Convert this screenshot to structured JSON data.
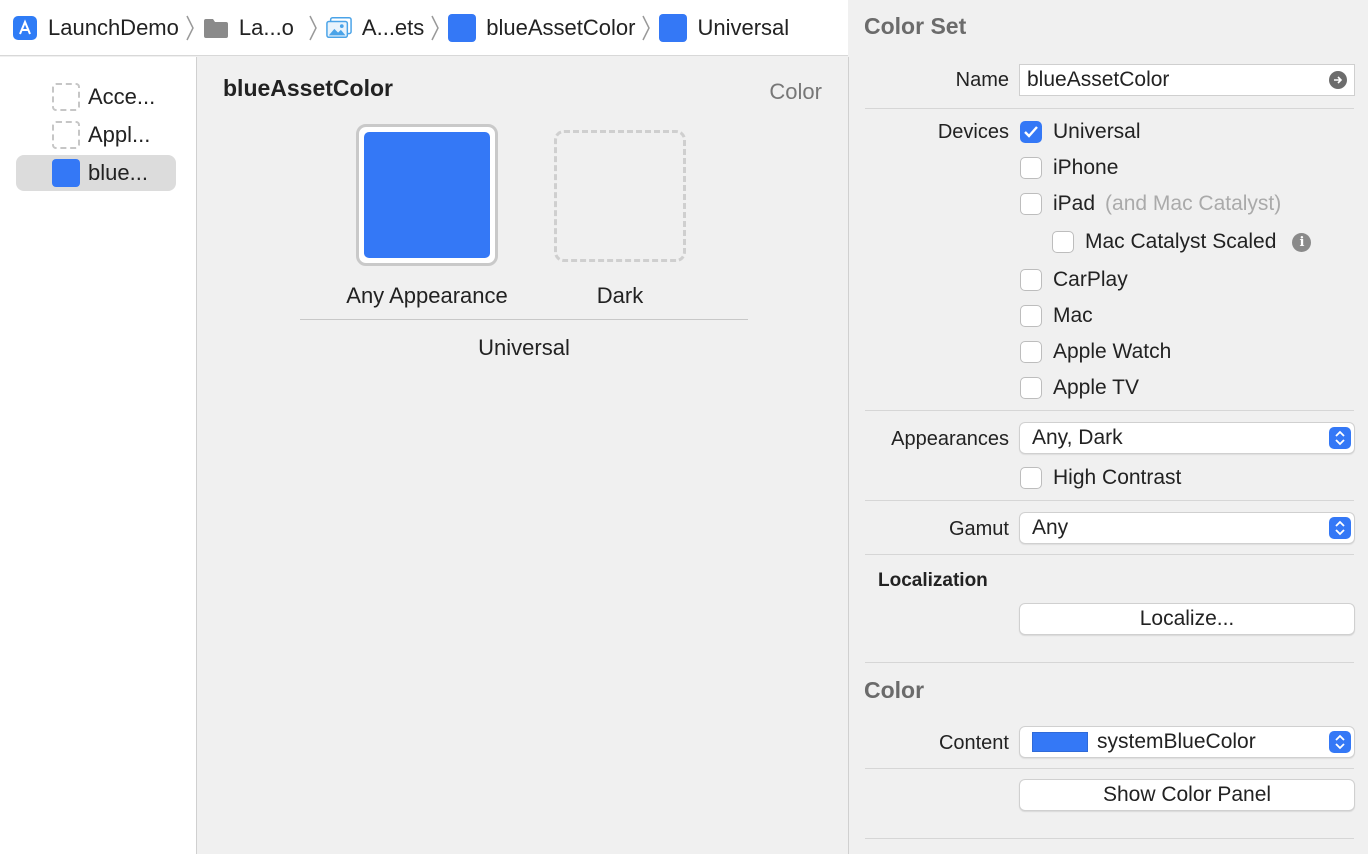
{
  "breadcrumb": {
    "items": [
      {
        "label": "LaunchDemo",
        "icon": "xcode-app-icon"
      },
      {
        "label": "La...o",
        "icon": "folder-icon"
      },
      {
        "label": "A...ets",
        "icon": "asset-catalog-icon"
      },
      {
        "label": "blueAssetColor",
        "icon": "color-swatch-icon"
      },
      {
        "label": "Universal",
        "icon": "color-swatch-icon"
      }
    ]
  },
  "asset_list": {
    "items": [
      {
        "label": "Acce..."
      },
      {
        "label": "Appl..."
      },
      {
        "label": "blue..."
      }
    ]
  },
  "editor": {
    "title": "blueAssetColor",
    "type": "Color",
    "wells": {
      "any": "Any Appearance",
      "dark": "Dark"
    },
    "group": "Universal"
  },
  "inspector": {
    "color_set": {
      "title": "Color Set",
      "name_label": "Name",
      "name_value": "blueAssetColor",
      "devices_label": "Devices",
      "devices": {
        "universal": "Universal",
        "iphone": "iPhone",
        "ipad": "iPad",
        "ipad_note": "(and Mac Catalyst)",
        "mac_catalyst_scaled": "Mac Catalyst Scaled",
        "carplay": "CarPlay",
        "mac": "Mac",
        "apple_watch": "Apple Watch",
        "apple_tv": "Apple TV"
      },
      "appearances_label": "Appearances",
      "appearances_value": "Any, Dark",
      "high_contrast": "High Contrast",
      "gamut_label": "Gamut",
      "gamut_value": "Any",
      "localization_title": "Localization",
      "localize_button": "Localize..."
    },
    "color": {
      "title": "Color",
      "content_label": "Content",
      "content_value": "systemBlueColor",
      "show_panel_button": "Show Color Panel"
    }
  },
  "colors": {
    "accent": "#3478f6"
  }
}
